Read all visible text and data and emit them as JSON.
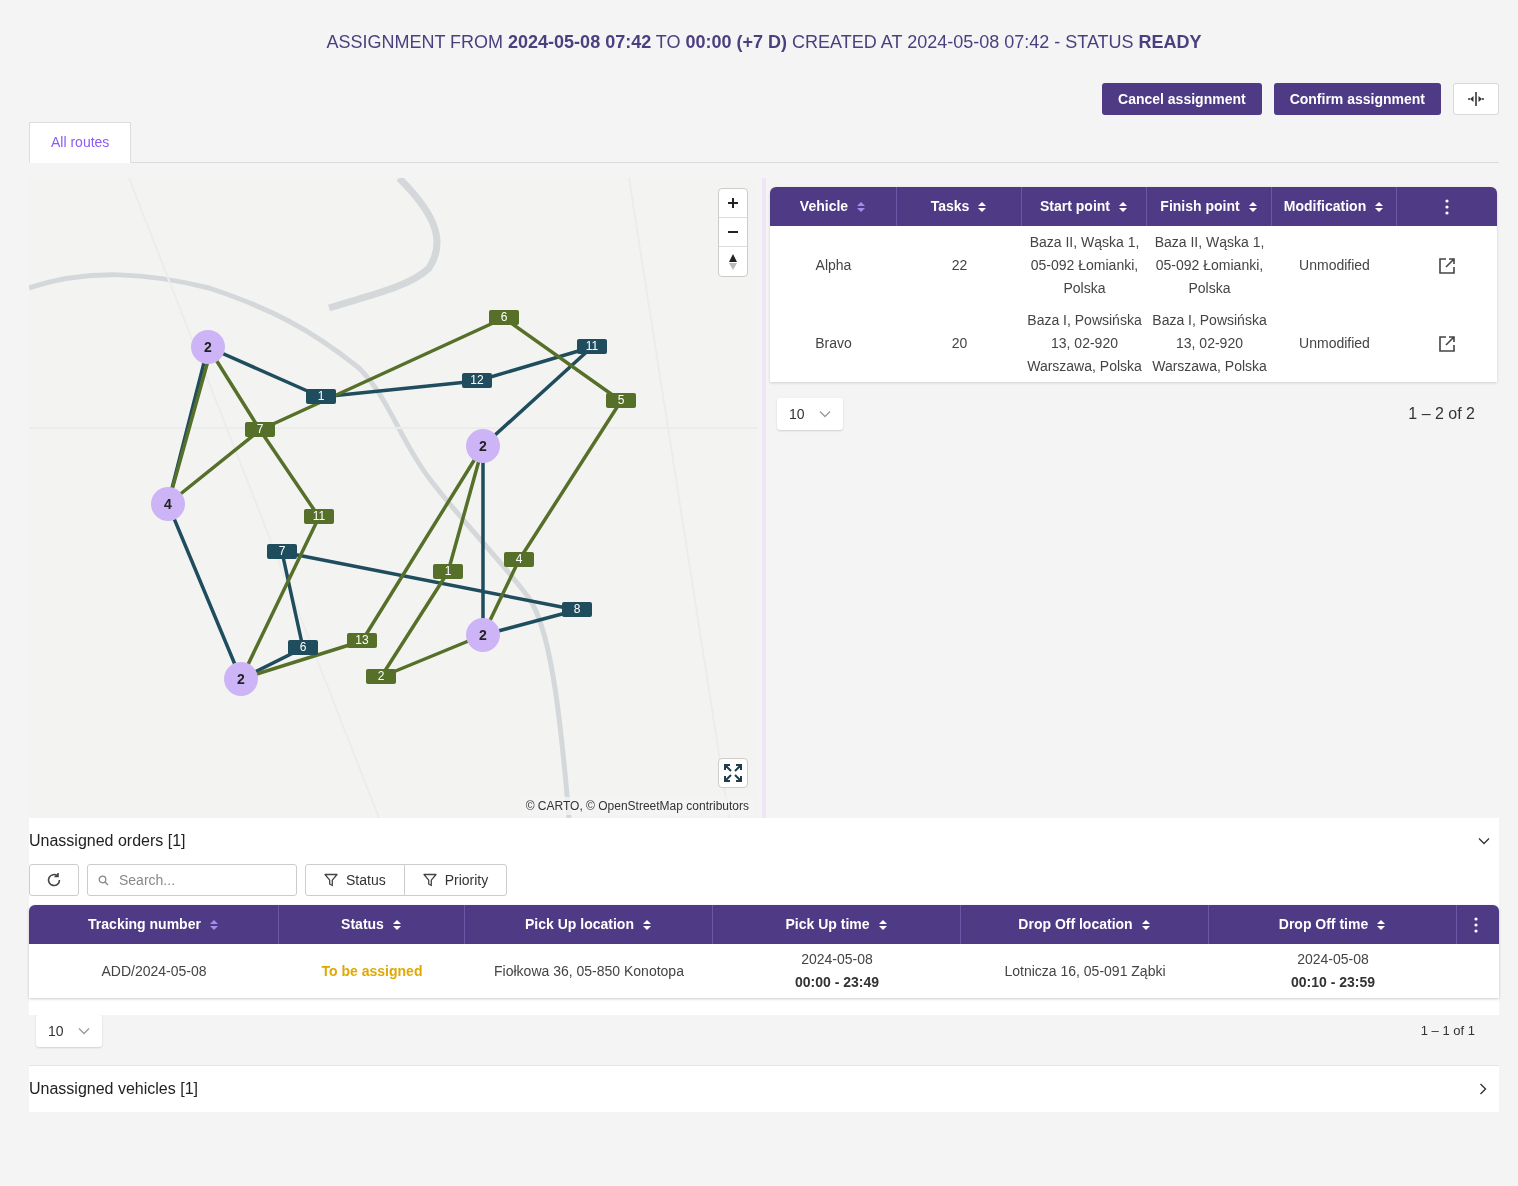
{
  "title": "ASSIGNMENT FROM **2024-05-08 07:42** TO **00:00 (+7 D)** CREATED AT 2024-05-08 07:42 - STATUS **READY**",
  "actions": [
    {
      "label": "Cancel assignment"
    },
    {
      "label": "Confirm assignment"
    }
  ],
  "tabs": [
    {
      "label": "All routes",
      "selected": true
    }
  ],
  "map": {
    "attribution": "© CARTO, © OpenStreetMap contributors",
    "routes": [
      {
        "color": "#1f4d5e",
        "stops": [
          "1",
          "12",
          "11",
          "7",
          "6",
          "8"
        ]
      },
      {
        "color": "#56702a",
        "stops": [
          "6",
          "7",
          "5",
          "11",
          "1",
          "4",
          "13",
          "2"
        ]
      }
    ],
    "clusters": [
      {
        "count": "2"
      },
      {
        "count": "4"
      },
      {
        "count": "2"
      },
      {
        "count": "2"
      },
      {
        "count": "2"
      }
    ]
  },
  "routes_table": {
    "columns": [
      {
        "label": "Vehicle",
        "sorted": true
      },
      {
        "label": "Tasks",
        "sorted": false
      },
      {
        "label": "Start point",
        "sorted": false
      },
      {
        "label": "Finish point",
        "sorted": false
      },
      {
        "label": "Modification",
        "sorted": false
      }
    ],
    "rows": [
      {
        "vehicle": "Alpha",
        "tasks": "22",
        "start_point": "Baza II, Wąska 1, 05-092 Łomianki, Polska",
        "finish_point": "Baza II, Wąska 1, 05-092 Łomianki, Polska",
        "modification": "Unmodified"
      },
      {
        "vehicle": "Bravo",
        "tasks": "20",
        "start_point": "Baza I, Powsińska 13, 02-920 Warszawa, Polska",
        "finish_point": "Baza I, Powsińska 13, 02-920 Warszawa, Polska",
        "modification": "Unmodified"
      }
    ],
    "page_size": "10",
    "range": "1 – 2 of 2"
  },
  "unassigned_orders": {
    "title": "Unassigned orders [1]",
    "expanded": true,
    "search_placeholder": "Search...",
    "filters": [
      "Status",
      "Priority"
    ],
    "columns": [
      {
        "label": "Tracking number",
        "sorted": true
      },
      {
        "label": "Status",
        "sorted": false
      },
      {
        "label": "Pick Up location",
        "sorted": false
      },
      {
        "label": "Pick Up time",
        "sorted": false
      },
      {
        "label": "Drop Off location",
        "sorted": false
      },
      {
        "label": "Drop Off time",
        "sorted": false
      }
    ],
    "rows": [
      {
        "tracking_number": "ADD/2024-05-08",
        "status": {
          "label": "To be assigned",
          "color": "#e0a800"
        },
        "pick_up_location": "Fiołkowa 36, 05-850 Konotopa",
        "pick_up_time": {
          "date": "2024-05-08",
          "range": "00:00 - 23:49"
        },
        "drop_off_location": "Lotnicza 16, 05-091 Ząbki",
        "drop_off_time": {
          "date": "2024-05-08",
          "range": "00:10 - 23:59"
        }
      }
    ],
    "page_size": "10",
    "range": "1 – 1 of 1"
  },
  "unassigned_vehicles": {
    "title": "Unassigned vehicles [1]",
    "expanded": false
  }
}
